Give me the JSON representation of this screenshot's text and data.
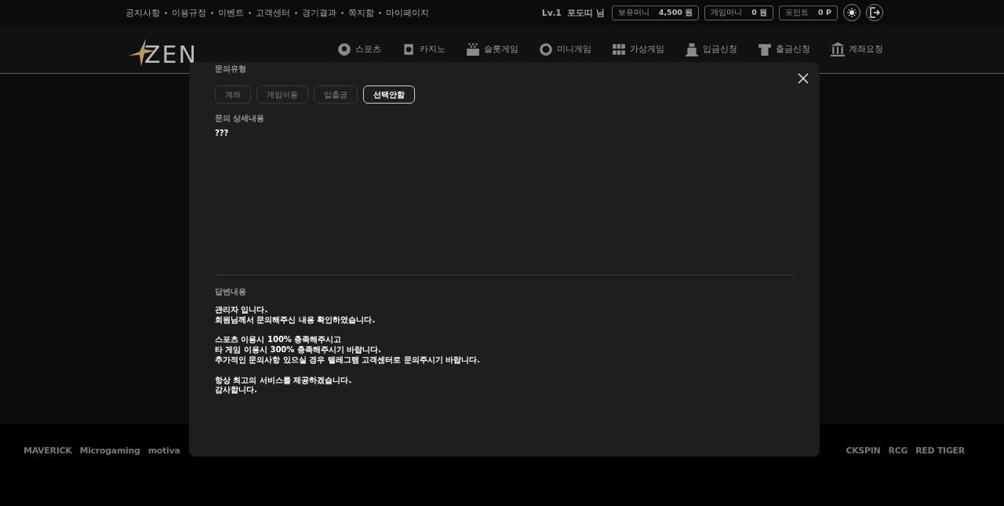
{
  "top_links": [
    "공지사항",
    "이용규정",
    "이벤트",
    "고객센터",
    "경기결과",
    "쪽지함",
    "마이페이지"
  ],
  "user": {
    "level": "Lv.1",
    "name": "포도띠 님"
  },
  "wallets": [
    {
      "label": "보유머니",
      "value": "4,500 원"
    },
    {
      "label": "게임머니",
      "value": "0 원"
    },
    {
      "label": "포인트",
      "value": "0 P"
    }
  ],
  "logo": "ZEN",
  "nav": [
    "스포츠",
    "카지노",
    "슬롯게임",
    "미니게임",
    "가상게임",
    "입금신청",
    "출금신청",
    "계좌요청"
  ],
  "providers_left": [
    "MAVERICK",
    "Microgaming",
    "motiva"
  ],
  "providers_right": [
    "CKSPIN",
    "RCG",
    "RED TIGER"
  ],
  "modal": {
    "type_label": "문의유형",
    "types": [
      {
        "label": "계좌",
        "selected": false
      },
      {
        "label": "게임이용",
        "selected": false
      },
      {
        "label": "입출금",
        "selected": false
      },
      {
        "label": "선택안함",
        "selected": true
      }
    ],
    "detail_label": "문의 상세내용",
    "detail": "???",
    "answer_label": "답변내용",
    "answer": [
      [
        "관리자 입니다.",
        "회원님께서 문의해주신 내용 확인하였습니다."
      ],
      [
        "스포츠 이용시 100% 충족해주시고",
        "타 게임 이용시 300% 충족해주시기 바랍니다.",
        "추가적인 문의사항 있으실 경우 텔레그램 고객센터로 문의주시기 바랍니다."
      ],
      [
        "항상 최고의 서비스를 제공하겠습니다.",
        "감사합니다."
      ]
    ]
  }
}
